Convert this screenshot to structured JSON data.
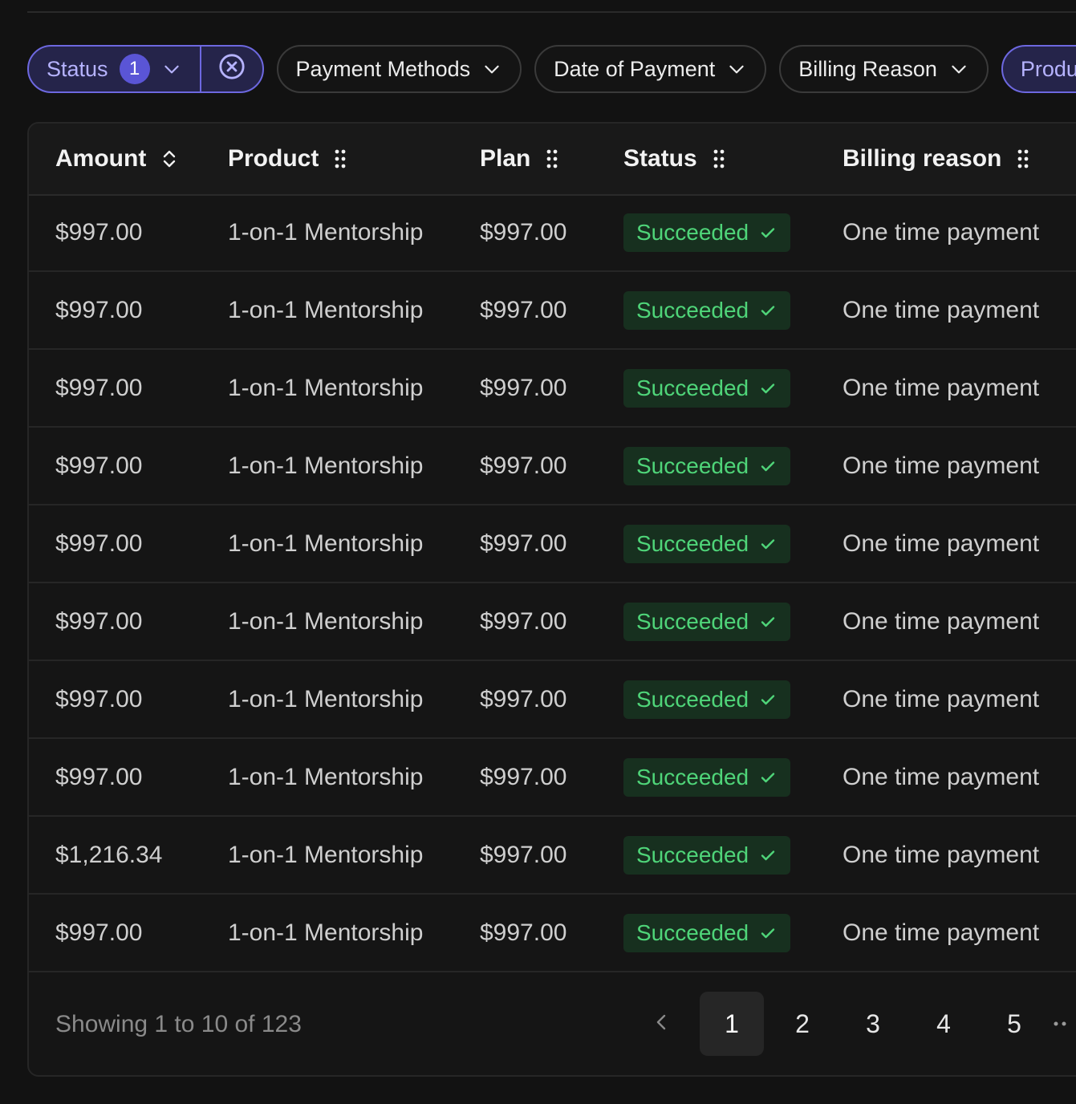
{
  "filters": {
    "status": {
      "label": "Status",
      "count": "1"
    },
    "payment_methods": {
      "label": "Payment Methods"
    },
    "date_of_payment": {
      "label": "Date of Payment"
    },
    "billing_reason": {
      "label": "Billing Reason"
    },
    "product": {
      "label": "Produ"
    }
  },
  "table": {
    "columns": {
      "amount": "Amount",
      "product": "Product",
      "plan": "Plan",
      "status": "Status",
      "billing_reason": "Billing reason"
    },
    "rows": [
      {
        "amount": "$997.00",
        "product": "1-on-1 Mentorship",
        "plan": "$997.00",
        "status": "Succeeded",
        "billing_reason": "One time payment"
      },
      {
        "amount": "$997.00",
        "product": "1-on-1 Mentorship",
        "plan": "$997.00",
        "status": "Succeeded",
        "billing_reason": "One time payment"
      },
      {
        "amount": "$997.00",
        "product": "1-on-1 Mentorship",
        "plan": "$997.00",
        "status": "Succeeded",
        "billing_reason": "One time payment"
      },
      {
        "amount": "$997.00",
        "product": "1-on-1 Mentorship",
        "plan": "$997.00",
        "status": "Succeeded",
        "billing_reason": "One time payment"
      },
      {
        "amount": "$997.00",
        "product": "1-on-1 Mentorship",
        "plan": "$997.00",
        "status": "Succeeded",
        "billing_reason": "One time payment"
      },
      {
        "amount": "$997.00",
        "product": "1-on-1 Mentorship",
        "plan": "$997.00",
        "status": "Succeeded",
        "billing_reason": "One time payment"
      },
      {
        "amount": "$997.00",
        "product": "1-on-1 Mentorship",
        "plan": "$997.00",
        "status": "Succeeded",
        "billing_reason": "One time payment"
      },
      {
        "amount": "$997.00",
        "product": "1-on-1 Mentorship",
        "plan": "$997.00",
        "status": "Succeeded",
        "billing_reason": "One time payment"
      },
      {
        "amount": "$1,216.34",
        "product": "1-on-1 Mentorship",
        "plan": "$997.00",
        "status": "Succeeded",
        "billing_reason": "One time payment"
      },
      {
        "amount": "$997.00",
        "product": "1-on-1 Mentorship",
        "plan": "$997.00",
        "status": "Succeeded",
        "billing_reason": "One time payment"
      }
    ]
  },
  "pagination": {
    "summary": "Showing 1 to 10 of 123",
    "pages": [
      "1",
      "2",
      "3",
      "4",
      "5"
    ],
    "current_page": "1"
  },
  "colors": {
    "background": "#121212",
    "accent": "#6d68e0",
    "success_text": "#4fd579",
    "success_bg": "#17301f"
  },
  "icons": {
    "chevron": "chevron-down-icon",
    "clear": "clear-circle-icon",
    "sort": "sort-icon",
    "drag": "drag-handle-icon",
    "check": "check-icon",
    "prev": "chevron-left-icon"
  }
}
